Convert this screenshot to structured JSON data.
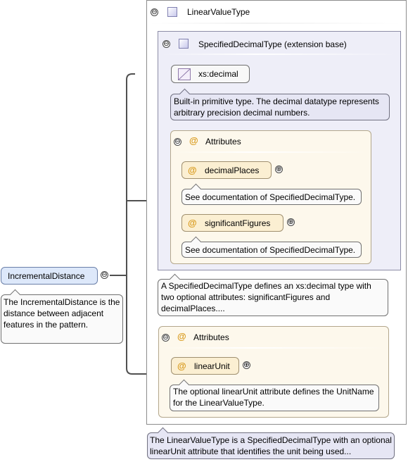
{
  "root": {
    "name": "IncrementalDistance",
    "doc": "The IncrementalDistance is the distance between adjacent features in the pattern."
  },
  "type": {
    "name": "LinearValueType",
    "doc": "The LinearValueType is a SpecifiedDecimalType with an optional linearUnit attribute that identifies the unit being used..."
  },
  "extension": {
    "name": "SpecifiedDecimalType (extension base)",
    "doc": "A SpecifiedDecimalType defines an xs:decimal type with two optional attributes: significantFigures and decimalPlaces....",
    "base": {
      "name": "xs:decimal",
      "doc": "Built-in primitive type. The decimal datatype represents arbitrary precision decimal numbers."
    },
    "attributes": {
      "header": "Attributes",
      "items": [
        {
          "name": "decimalPlaces",
          "doc": "See documentation of SpecifiedDecimalType."
        },
        {
          "name": "significantFigures",
          "doc": "See documentation of SpecifiedDecimalType."
        }
      ]
    }
  },
  "own_attributes": {
    "header": "Attributes",
    "items": [
      {
        "name": "linearUnit",
        "doc": "The optional linearUnit attribute defines the UnitName for the LinearValueType."
      }
    ]
  },
  "symbols": {
    "collapse": "⊖",
    "expand": "⊕",
    "attribute": "@"
  },
  "colors": {
    "element_fill": "#dde8fa",
    "attribute_fill": "#fbefd2",
    "extension_fill": "#eeeef8",
    "attribute_group_fill": "#fdf8ec",
    "connector": "#505050"
  }
}
